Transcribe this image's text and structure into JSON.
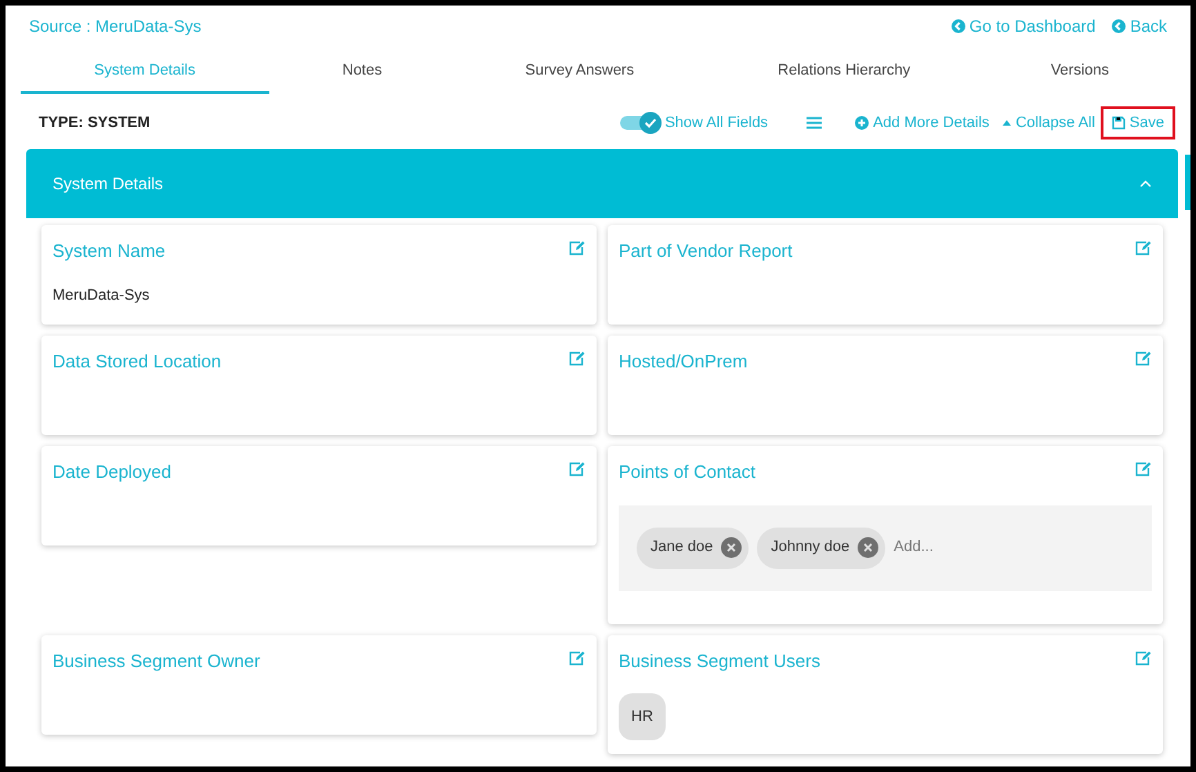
{
  "source": "Source : MeruData-Sys",
  "nav_links": [
    "Go to Dashboard",
    "Back"
  ],
  "tabs": [
    {
      "label": "System Details",
      "selected": true
    },
    {
      "label": "Notes",
      "selected": false
    },
    {
      "label": "Survey Answers",
      "selected": false
    },
    {
      "label": "Relations Hierarchy",
      "selected": false
    },
    {
      "label": "Versions",
      "selected": false
    }
  ],
  "toolbar": {
    "type_label": "TYPE: SYSTEM",
    "show_all_fields": {
      "label": "Show All Fields",
      "on": true
    },
    "add_more": "Add More Details",
    "collapse_all": "Collapse All",
    "save": {
      "label": "Save",
      "highlighted": true
    }
  },
  "section": {
    "title": "System Details",
    "expanded": true,
    "fields": [
      {
        "kind": "text",
        "label": "System Name",
        "value": "MeruData-Sys"
      },
      {
        "kind": "text",
        "label": "Part of Vendor Report"
      },
      {
        "kind": "text",
        "label": "Data Stored Location"
      },
      {
        "kind": "text",
        "label": "Hosted/OnPrem"
      },
      {
        "kind": "text",
        "label": "Date Deployed"
      },
      {
        "kind": "tags",
        "label": "Points of Contact",
        "tags": [
          "Jane doe",
          "Johnny doe"
        ],
        "placeholder": "Add..."
      },
      {
        "kind": "text",
        "label": "Business Segment Owner"
      },
      {
        "kind": "chips",
        "label": "Business Segment Users",
        "chips": [
          "HR"
        ]
      }
    ]
  }
}
